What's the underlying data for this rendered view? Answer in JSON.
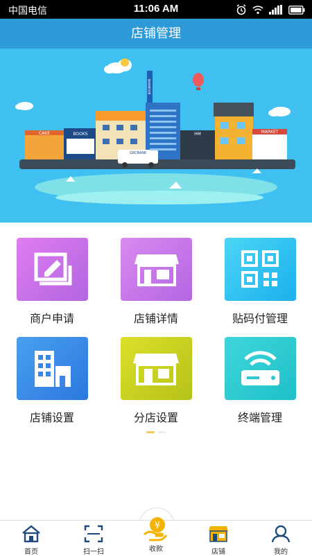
{
  "status_bar": {
    "carrier": "中国电信",
    "time": "11:06 AM"
  },
  "header": {
    "title": "店铺管理"
  },
  "banner": {
    "shop_signs": [
      "CAKE",
      "BOOKS",
      "HM",
      "MARKET"
    ],
    "truck_text": "GRCBANK",
    "tower_text": "BDGBBANK"
  },
  "tiles": [
    {
      "label": "商户申请",
      "color": "#c977e8",
      "icon": "edit-icon"
    },
    {
      "label": "店铺详情",
      "color": "#c977e8",
      "icon": "storefront-icon"
    },
    {
      "label": "贴码付管理",
      "color": "#29c0f0",
      "icon": "qr-code-icon"
    },
    {
      "label": "店铺设置",
      "color": "#3b8fe6",
      "icon": "building-icon"
    },
    {
      "label": "分店设置",
      "color": "#c4cc1e",
      "icon": "branch-store-icon"
    },
    {
      "label": "终端管理",
      "color": "#2cc8cf",
      "icon": "router-icon"
    }
  ],
  "tabbar": {
    "items": [
      {
        "label": "首页",
        "icon": "home-icon"
      },
      {
        "label": "扫一扫",
        "icon": "scan-icon"
      },
      {
        "label": "收款",
        "icon": "collect-money-icon"
      },
      {
        "label": "店铺",
        "icon": "shop-icon"
      },
      {
        "label": "我的",
        "icon": "profile-icon"
      }
    ]
  },
  "colors": {
    "header_bg": "#2e9bd8",
    "banner_bg": "#3fc0f0",
    "tab_accent": "#f4b300"
  }
}
